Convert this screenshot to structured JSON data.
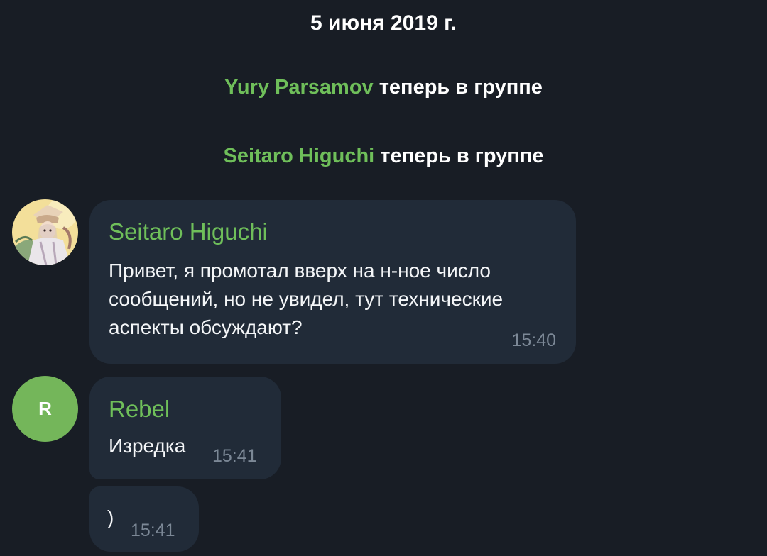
{
  "date_header": "5 июня 2019 г.",
  "service_messages": [
    {
      "name": "Yury Parsamov",
      "text": " теперь в группе"
    },
    {
      "name": "Seitaro Higuchi",
      "text": " теперь в группе"
    }
  ],
  "messages": [
    {
      "sender": "Seitaro Higuchi",
      "text": "Привет, я промотал вверх на н-ное число сообщений, но не увидел, тут технические аспекты обсуждают?",
      "time": "15:40",
      "avatar": "illustrated-character-avatar"
    },
    {
      "sender": "Rebel",
      "text": "Изредка",
      "time": "15:41",
      "avatar_letter": "R"
    },
    {
      "text": ")",
      "time": "15:41"
    }
  ],
  "colors": {
    "background": "#181d25",
    "bubble": "#212b38",
    "name_green": "#6fbf5a",
    "time_gray": "#7c8896",
    "avatar_green": "#74b65a"
  }
}
